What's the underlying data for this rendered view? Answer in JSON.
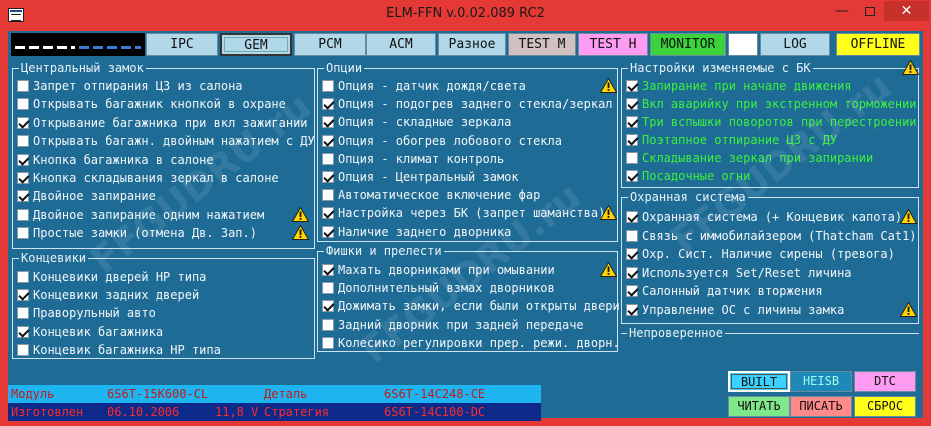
{
  "window": {
    "title": "ELM-FFN    v.0.02.089 RC2",
    "min": "—",
    "max": "",
    "close": "✕"
  },
  "toolbar": {
    "buttons": [
      {
        "label": "IPC",
        "bg": "#b0d8e8"
      },
      {
        "label": "GEM",
        "bg": "#b0d8e8"
      },
      {
        "label": "PCM",
        "bg": "#b0d8e8"
      },
      {
        "label": "ACM",
        "bg": "#b0d8e8"
      },
      {
        "label": "Разное",
        "bg": "#b0d8e8"
      },
      {
        "label": "TEST M",
        "bg": "#d0c0c0"
      },
      {
        "label": "TEST H",
        "bg": "#ff9cf2"
      },
      {
        "label": "MONITOR",
        "bg": "#3cd23c"
      },
      {
        "label": "",
        "bg": "#ffffff"
      },
      {
        "label": "LOG",
        "bg": "#b0d8e8"
      },
      {
        "label": "OFFLINE",
        "bg": "#ffff1a"
      }
    ]
  },
  "groups": {
    "central": {
      "title": "Центральный замок",
      "items": [
        {
          "label": "Запрет отпирания ЦЗ из салона",
          "checked": false,
          "warn": false
        },
        {
          "label": "Открывать багажник кнопкой в охране",
          "checked": false,
          "warn": false
        },
        {
          "label": "Открывание багажника при вкл зажигании",
          "checked": true,
          "warn": false
        },
        {
          "label": "Открывать багажн. двойным нажатием с ДУ",
          "checked": false,
          "warn": false
        },
        {
          "label": "Кнопка багажника в салоне",
          "checked": true,
          "warn": false
        },
        {
          "label": "Кнопка складывания зеркал в салоне",
          "checked": true,
          "warn": false
        },
        {
          "label": "Двойное запирание",
          "checked": true,
          "warn": false
        },
        {
          "label": "Двойное запирание одним нажатием",
          "checked": false,
          "warn": true
        },
        {
          "label": "Простые замки (отмена Дв. Зап.)",
          "checked": false,
          "warn": true
        }
      ]
    },
    "switches": {
      "title": "Концевики",
      "items": [
        {
          "label": "Концевики дверей НР типа",
          "checked": false
        },
        {
          "label": "Концевики задних дверей",
          "checked": true
        },
        {
          "label": "Праворульный авто",
          "checked": false
        },
        {
          "label": "Концевик багажника",
          "checked": true
        },
        {
          "label": "Концевик багажника НР типа",
          "checked": false
        }
      ]
    },
    "options": {
      "title": "Опции",
      "items": [
        {
          "label": "Опция - датчик дождя/света",
          "checked": false,
          "warn": true
        },
        {
          "label": "Опция - подогрев заднего стекла/зеркал",
          "checked": true,
          "warn": false
        },
        {
          "label": "Опция - складные зеркала",
          "checked": true,
          "warn": false
        },
        {
          "label": "Опция - обогрев лобового стекла",
          "checked": true,
          "warn": false
        },
        {
          "label": "Опция - климат контроль",
          "checked": false,
          "warn": false
        },
        {
          "label": "Опция - Центральный замок",
          "checked": true,
          "warn": false
        },
        {
          "label": "Автоматическое включение фар",
          "checked": false,
          "warn": false
        },
        {
          "label": "Настройка через БК (запрет шаманства)",
          "checked": true,
          "warn": true
        },
        {
          "label": "Наличие заднего дворника",
          "checked": true,
          "warn": false
        }
      ]
    },
    "tricks": {
      "title": "Фишки и прелести",
      "items": [
        {
          "label": "Махать дворниками при омывании",
          "checked": true,
          "warn": true
        },
        {
          "label": "Дополнительный взмах дворников",
          "checked": false,
          "warn": false
        },
        {
          "label": "Дожимать замки, если были открыты двери",
          "checked": true,
          "warn": false
        },
        {
          "label": "Задний дворник при задней передаче",
          "checked": false,
          "warn": false
        },
        {
          "label": "Колесико регулировки прер. режи. дворн.",
          "checked": false,
          "warn": false
        }
      ]
    },
    "bk": {
      "title": "Настройки изменяемые с БК",
      "items": [
        {
          "label": "Запирание при начале движения",
          "checked": true
        },
        {
          "label": "Вкл аварийку при экстренном торможении",
          "checked": true
        },
        {
          "label": "Три вспышки поворотов при перестроении",
          "checked": true
        },
        {
          "label": "Поэтапное отпирание ЦЗ с ДУ",
          "checked": true
        },
        {
          "label": "Складывание зеркал при запирании",
          "checked": false
        },
        {
          "label": "Посадочные огни",
          "checked": true
        }
      ]
    },
    "alarm": {
      "title": "Охранная система",
      "items": [
        {
          "label": "Охранная система (+ Концевик капота)",
          "checked": true,
          "warn": true
        },
        {
          "label": "Связь с иммобилайзером (Thatcham Cat1)",
          "checked": false,
          "warn": false
        },
        {
          "label": "Охр. Сист. Наличие сирены (тревога)",
          "checked": true,
          "warn": false
        },
        {
          "label": "Используется Set/Reset личина",
          "checked": true,
          "warn": false
        },
        {
          "label": "Салонный датчик вторжения",
          "checked": true,
          "warn": false
        },
        {
          "label": "Управление ОС с личины замка",
          "checked": true,
          "warn": true
        }
      ]
    },
    "unchecked": {
      "title": "Непроверенное"
    }
  },
  "info": {
    "module_label": "Модуль",
    "module_value": "6S6T-15K600-CL",
    "made_label": "Изготовлен",
    "made_value": "06.10.2006",
    "volt_value": "11,8 V",
    "part_label": "Деталь",
    "part_value": "6S6T-14C248-CE",
    "strategy_label": "Стратегия",
    "strategy_value": "6S6T-14C100-DC"
  },
  "buttons": {
    "built": "BUILT",
    "heisb": "HEISB",
    "dtc": "DTC",
    "read": "ЧИТАТЬ",
    "write": "ПИСАТЬ",
    "reset": "СБРОС"
  },
  "watermark": "FFGUDRU.ru",
  "colors": {
    "panel": "#1e6b96",
    "frame": "#e53935",
    "bk_text": "#3cf03c"
  }
}
